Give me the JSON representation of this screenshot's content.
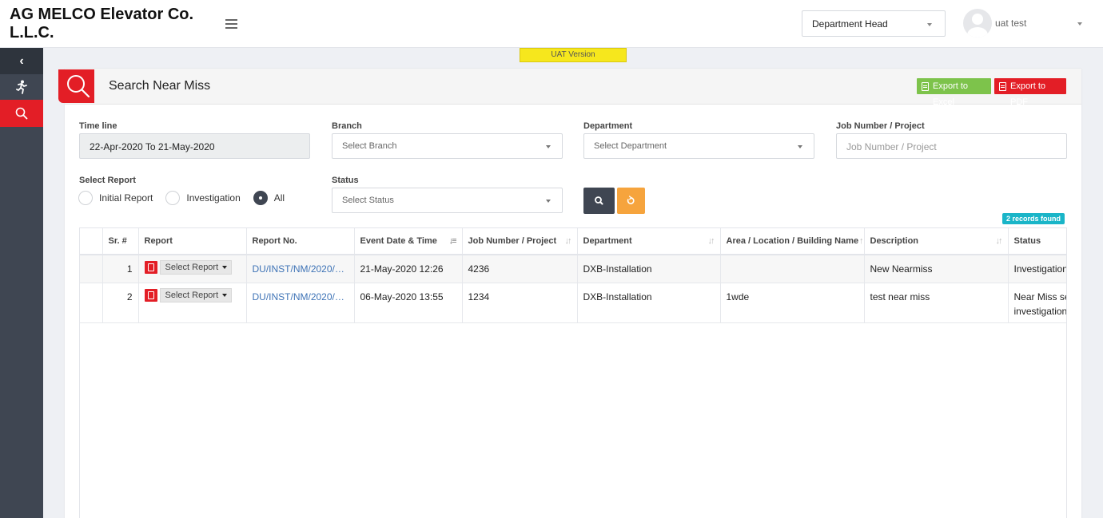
{
  "header": {
    "brand": "AG MELCO Elevator Co. L.L.C.",
    "role_selected": "Department Head",
    "username": "uat test"
  },
  "banner": {
    "env": "UAT Version"
  },
  "page": {
    "title": "Search Near Miss",
    "export_excel": "Export to Excel",
    "export_pdf": "Export to PDF"
  },
  "filters": {
    "timeline_label": "Time line",
    "timeline_value": "22-Apr-2020 To 21-May-2020",
    "branch_label": "Branch",
    "branch_placeholder": "Select Branch",
    "department_label": "Department",
    "department_placeholder": "Select Department",
    "job_label": "Job Number / Project",
    "job_placeholder": "Job Number / Project",
    "report_label": "Select Report",
    "report_options": [
      "Initial Report",
      "Investigation",
      "All"
    ],
    "report_selected": "All",
    "status_label": "Status",
    "status_placeholder": "Select Status"
  },
  "results": {
    "count_text": "2 records found",
    "columns": [
      "Sr. #",
      "Report",
      "Report No.",
      "Event Date & Time",
      "Job Number / Project",
      "Department",
      "Area / Location / Building Name",
      "Description",
      "Status"
    ],
    "rows": [
      {
        "sr": "1",
        "report_action": "Select Report",
        "report_no": "DU/INST/NM/2020/0...",
        "event_date": "21-May-2020 12:26",
        "job": "4236",
        "department": "DXB-Installation",
        "area": "",
        "description": "New Nearmiss",
        "status": "Investigation"
      },
      {
        "sr": "2",
        "report_action": "Select Report",
        "report_no": "DU/INST/NM/2020/0...",
        "event_date": "06-May-2020 13:55",
        "job": "1234",
        "department": "DXB-Installation",
        "area": "1wde",
        "description": "test near miss",
        "status": "Near Miss se investigation"
      }
    ]
  },
  "colors": {
    "brand_red": "#e31e26",
    "sidebar": "#3f4652",
    "excel_green": "#7dc34b",
    "reset_orange": "#f6a43d",
    "badge_teal": "#1ab5c8",
    "uat_yellow": "#f6e71d"
  }
}
